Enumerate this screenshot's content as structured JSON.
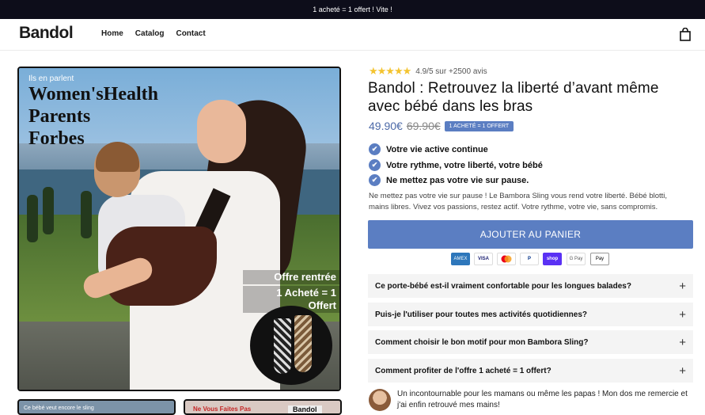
{
  "announcement": "1 acheté = 1 offert ! Vite !",
  "header": {
    "logo": "Bandol",
    "nav": [
      "Home",
      "Catalog",
      "Contact"
    ]
  },
  "hero": {
    "press_label": "Ils en parlent",
    "press_names": [
      "Women'sHealth",
      "Parents",
      "Forbes"
    ],
    "offer_line1": "Offre rentrée",
    "offer_line2": "1 Acheté = 1 Offert"
  },
  "thumbnails": {
    "thumb1_text": "Ce bébé veut encore le sling",
    "thumb2_left": "Ne Vous Faites Pas",
    "thumb2_right": "Bandol"
  },
  "product": {
    "stars": "★★★★★",
    "rating_text": "4.9/5 sur +2500 avis",
    "title": "Bandol : Retrouvez la liberté d’avant même avec bébé dans les bras",
    "price": "49.90€",
    "compare_price": "69.90€",
    "badge": "1 ACHETÉ = 1 OFFERT",
    "features": [
      "Votre vie active continue",
      "Votre rythme, votre liberté, votre bébé",
      "Ne mettez pas votre vie sur pause."
    ],
    "description": "Ne mettez pas votre vie sur pause ! Le Bambora Sling vous rend votre liberté. Bébé blotti, mains libres. Vivez vos passions, restez actif. Votre rythme, votre vie, sans compromis.",
    "cta": "AJOUTER AU PANIER",
    "payments": [
      "AMEX",
      "VISA",
      "MC",
      "PayPal",
      "shop",
      "G Pay",
      "Pay"
    ]
  },
  "faq": [
    "Ce porte-bébé est-il vraiment confortable pour les longues balades?",
    "Puis-je l'utiliser pour toutes mes activités quotidiennes?",
    "Comment choisir le bon motif pour mon Bambora Sling?",
    "Comment profiter de l'offre 1 acheté = 1 offert?"
  ],
  "review": "Un incontournable pour les mamans ou même les papas ! Mon dos me remercie et j'ai enfin retrouvé mes mains!",
  "colors": {
    "accent": "#5b7ec2",
    "announcement_bg": "#0d0d1a",
    "star": "#f4c430"
  }
}
